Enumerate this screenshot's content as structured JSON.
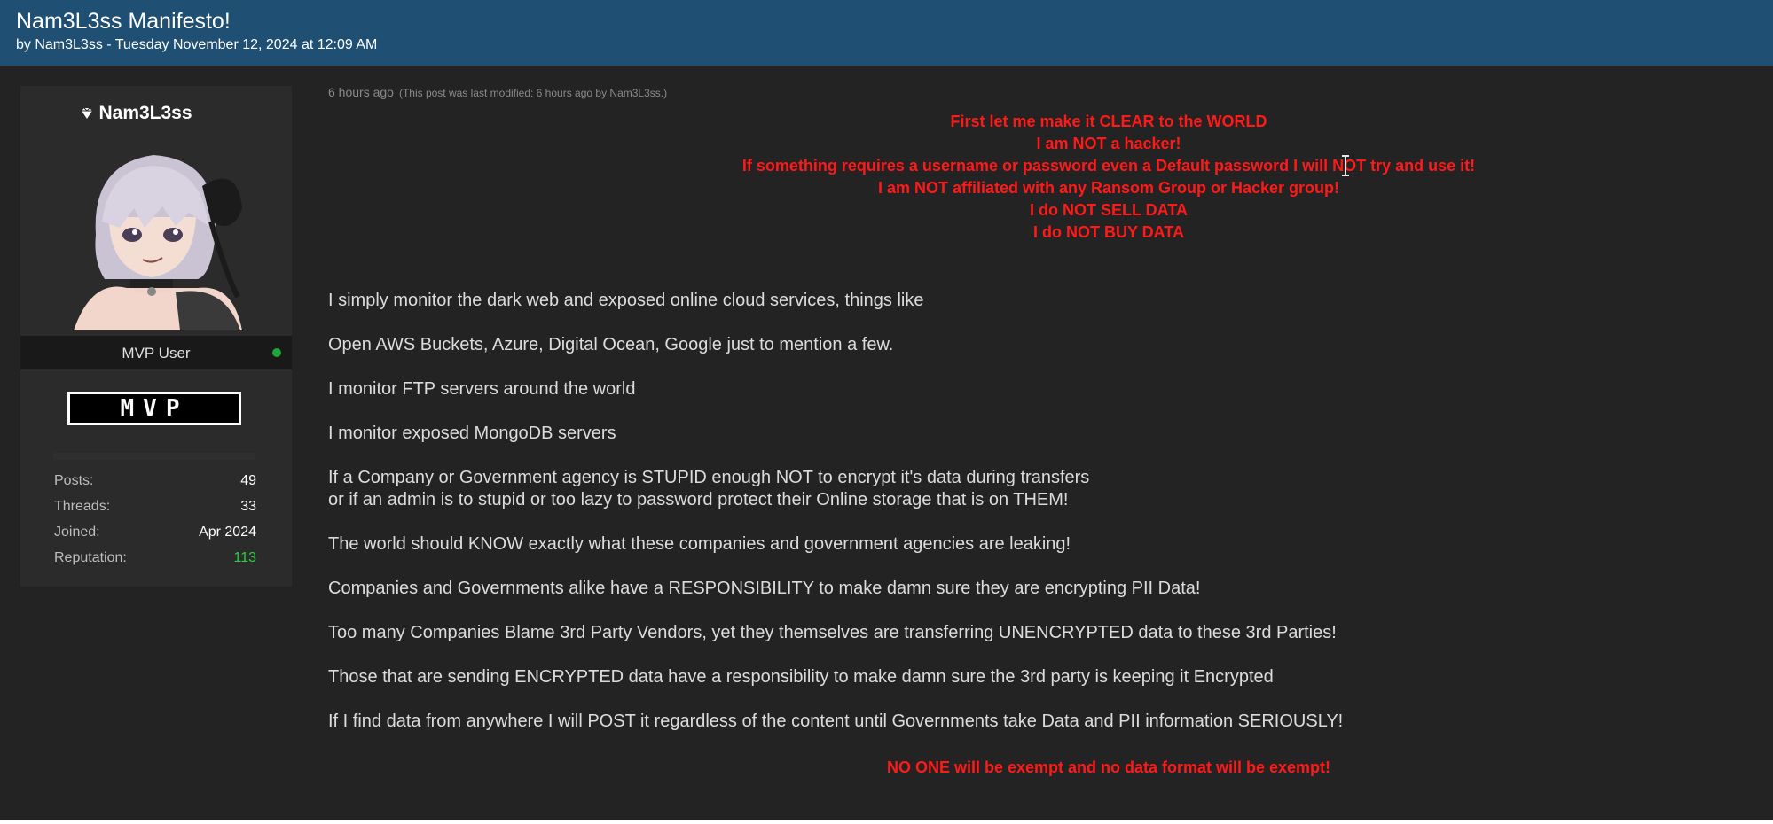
{
  "thread": {
    "title": "Nam3L3ss Manifesto!",
    "byline": "by Nam3L3ss - Tuesday November 12, 2024 at 12:09 AM"
  },
  "user": {
    "name": "Nam3L3ss",
    "rank": "MVP User",
    "badge": "MVP",
    "stats": [
      {
        "label": "Posts:",
        "value": "49"
      },
      {
        "label": "Threads:",
        "value": "33"
      },
      {
        "label": "Joined:",
        "value": "Apr 2024"
      },
      {
        "label": "Reputation:",
        "value": "113"
      }
    ]
  },
  "post": {
    "time": "6 hours ago",
    "modified": "(This post was last modified: 6 hours ago by Nam3L3ss.)",
    "notice": [
      "First let me make it CLEAR to the WORLD",
      "I am NOT a hacker!",
      "If something requires a username or password even a Default password I will NOT try and use it!",
      "I am NOT affiliated with any Ransom Group or Hacker group!",
      "I do NOT SELL DATA",
      "I do NOT BUY DATA"
    ],
    "body": [
      "I simply monitor the dark web and exposed online cloud services, things like",
      "Open AWS Buckets, Azure, Digital Ocean, Google just to mention a few.",
      "I monitor FTP servers around the world",
      "I monitor exposed MongoDB servers",
      "If a Company or Government agency is STUPID enough NOT to encrypt it's data during transfers",
      "or if an admin is to stupid or too lazy to password protect their Online storage that is on THEM!",
      "The world should KNOW exactly what these companies and government agencies are leaking!",
      "Companies and Governments alike have a RESPONSIBILITY to make damn sure they are encrypting PII Data!",
      "Too many Companies Blame 3rd Party Vendors, yet they themselves are transferring UNENCRYPTED data to these 3rd Parties!",
      "Those that are sending ENCRYPTED data have a responsibility to make damn sure the 3rd party is keeping it Encrypted",
      "If I find data from anywhere I will POST it regardless of the content until Governments take Data and PII information SERIOUSLY!"
    ],
    "closing": "NO ONE will be exempt and no data format will be exempt!"
  },
  "colors": {
    "header": "#1f4f72",
    "background": "#232323",
    "card": "#2b2b2b",
    "notice_red": "#ff1a1a",
    "online_green": "#1fa53a"
  }
}
